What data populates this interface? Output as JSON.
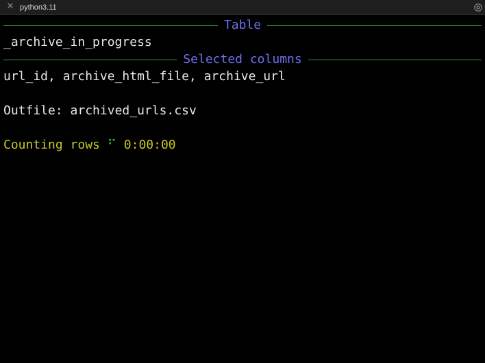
{
  "tab": {
    "title": "python3.11",
    "close_glyph": "✕"
  },
  "terminal": {
    "table_rule_title": "Table",
    "table_name": "_archive_in_progress",
    "columns_rule_title": "Selected columns",
    "columns": "url_id, archive_html_file, archive_url",
    "outfile_label": "Outfile:",
    "outfile_value": "archived_urls.csv",
    "progress_label": "Counting rows",
    "spinner_glyph": "⠋",
    "elapsed": "0:00:00"
  },
  "colors": {
    "rule_line": "#2ea043",
    "rule_title": "#6f6ff2",
    "progress_text": "#c8c826",
    "spinner": "#38b245",
    "foreground": "#e8e8e8",
    "background": "#000000"
  },
  "icons": {
    "close": "close-icon",
    "settings": "gear-icon"
  }
}
